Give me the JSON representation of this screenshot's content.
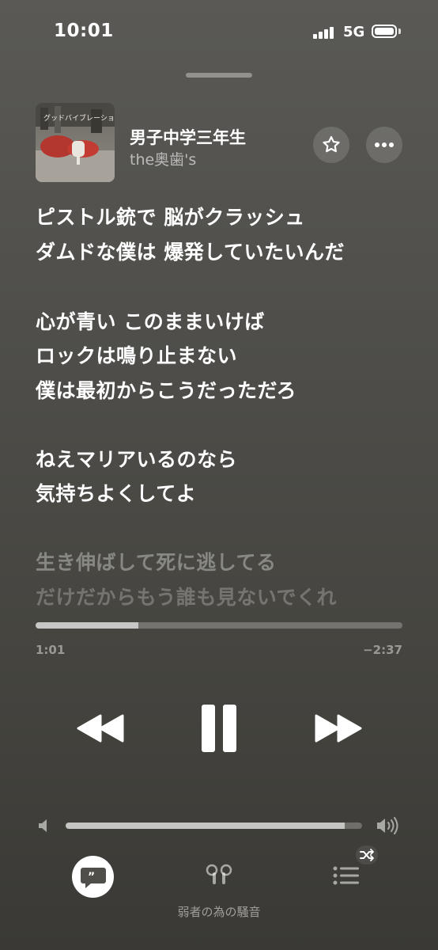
{
  "status_bar": {
    "time": "10:01",
    "network": "5G",
    "icons": [
      "signal-icon",
      "battery-icon"
    ]
  },
  "now_playing": {
    "album_art_text": "グッドバイブレーション",
    "title": "男子中学三年生",
    "artist": "the奥歯's",
    "favorite_icon": "star-icon",
    "more_icon": "ellipsis-icon"
  },
  "lyrics": [
    {
      "text": "ピストル銃で 脳がクラッシュ",
      "state": "past"
    },
    {
      "text": "ダムドな僕は 爆発していたいんだ",
      "state": "past"
    },
    {
      "text": "心が青い このままいけば",
      "state": "past"
    },
    {
      "text": "ロックは鳴り止まない",
      "state": "past"
    },
    {
      "text": "僕は最初からこうだっただろ",
      "state": "past"
    },
    {
      "text": "ねえマリアいるのなら",
      "state": "current"
    },
    {
      "text": "気持ちよくしてよ",
      "state": "current"
    },
    {
      "text": "生き伸ばして死に逃してる",
      "state": "upcoming"
    },
    {
      "text": "だけだからもう誰も見ないでくれ",
      "state": "upcoming"
    }
  ],
  "playback": {
    "elapsed": "1:01",
    "remaining": "−2:37",
    "progress_fraction": 0.28,
    "controls": [
      "rewind-icon",
      "pause-icon",
      "fast-forward-icon"
    ]
  },
  "volume": {
    "level_fraction": 0.94,
    "icons": [
      "volume-low-icon",
      "volume-high-icon"
    ]
  },
  "bottom_bar": {
    "lyrics_icon": "lyrics-bubble-icon",
    "airplay_icon": "airpods-icon",
    "device_name": "弱者の為の騒音",
    "queue_icon": "queue-list-icon",
    "shuffle_icon": "shuffle-icon"
  }
}
